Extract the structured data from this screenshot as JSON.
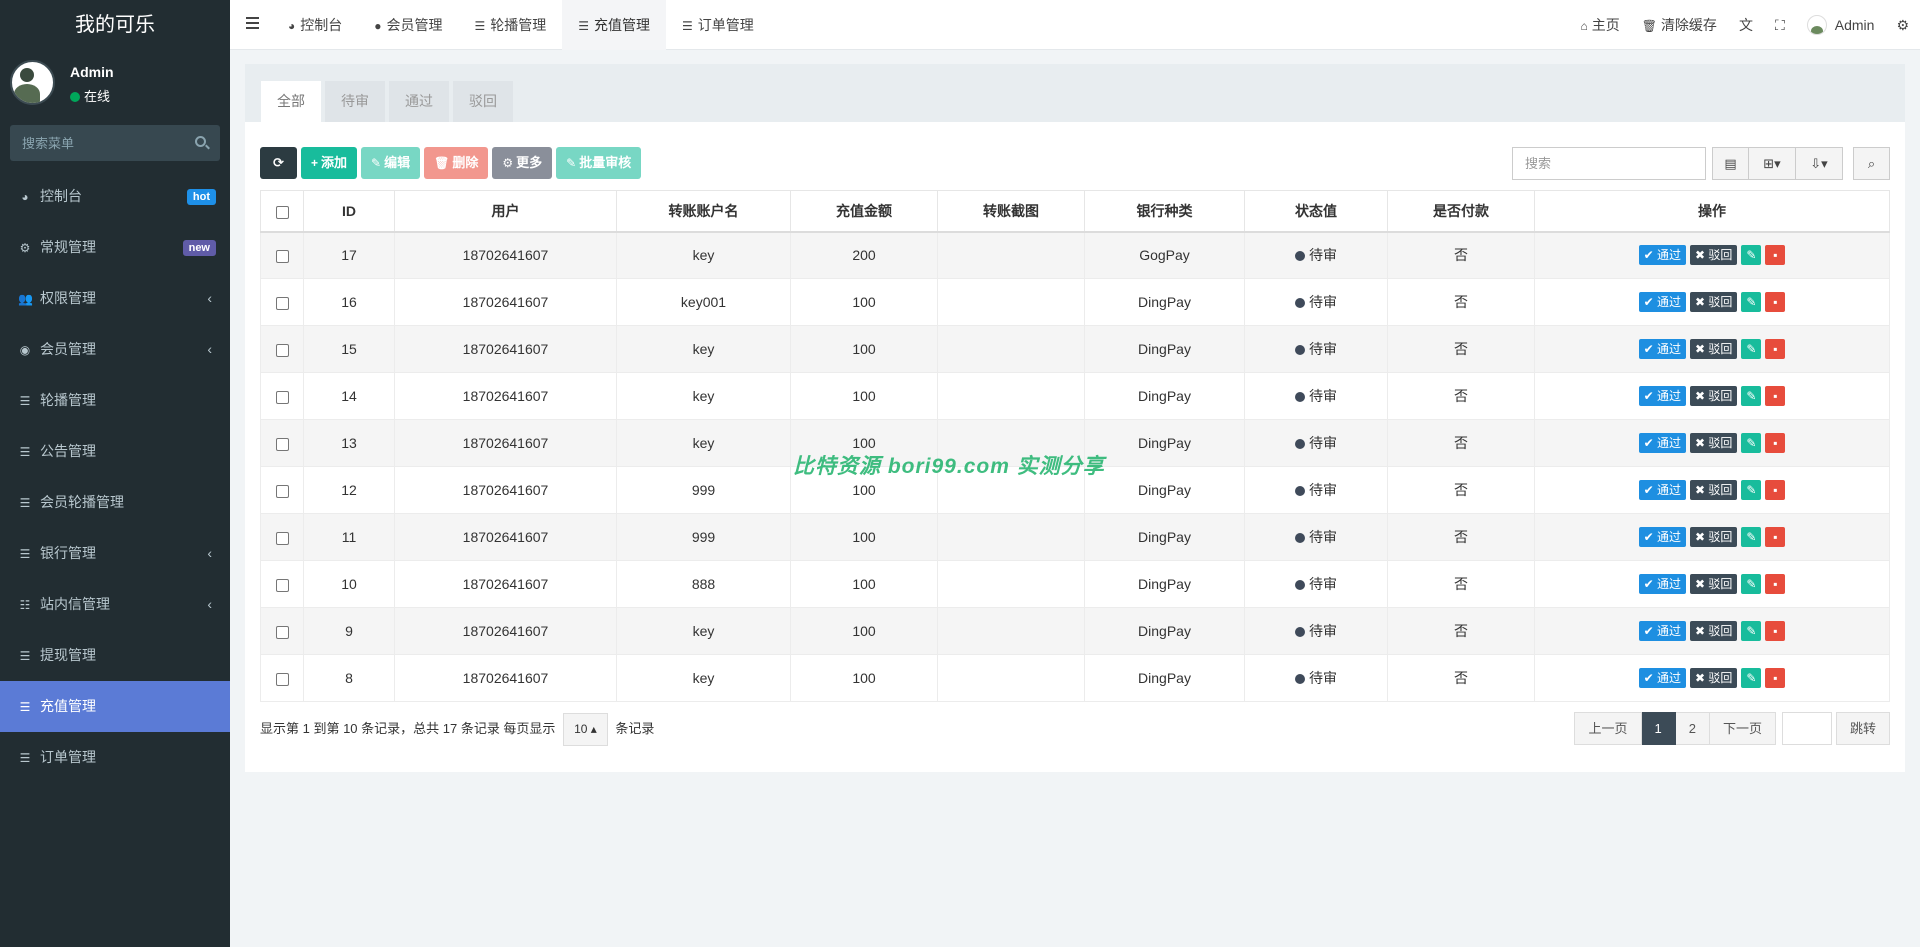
{
  "sidebar": {
    "logo": "我的可乐",
    "user": {
      "name": "Admin",
      "status": "在线"
    },
    "search_placeholder": "搜索菜单",
    "items": [
      {
        "label": "控制台",
        "icon": "dashboard-icon",
        "badge": "hot"
      },
      {
        "label": "常规管理",
        "icon": "cogs-icon",
        "badge": "new"
      },
      {
        "label": "权限管理",
        "icon": "users-icon",
        "caret": "‹"
      },
      {
        "label": "会员管理",
        "icon": "user-circle-icon",
        "caret": "‹"
      },
      {
        "label": "轮播管理",
        "icon": "list-icon"
      },
      {
        "label": "公告管理",
        "icon": "list-icon"
      },
      {
        "label": "会员轮播管理",
        "icon": "list-icon"
      },
      {
        "label": "银行管理",
        "icon": "list-icon",
        "caret": "‹"
      },
      {
        "label": "站内信管理",
        "icon": "list-alt-icon",
        "caret": "‹"
      },
      {
        "label": "提现管理",
        "icon": "list-icon"
      },
      {
        "label": "充值管理",
        "icon": "list-icon",
        "active": true
      },
      {
        "label": "订单管理",
        "icon": "list-icon"
      }
    ]
  },
  "topbar": {
    "tabs": [
      {
        "label": "控制台",
        "icon": "dashboard-icon"
      },
      {
        "label": "会员管理",
        "icon": "user-icon"
      },
      {
        "label": "轮播管理",
        "icon": "list-icon"
      },
      {
        "label": "充值管理",
        "icon": "list-icon",
        "active": true
      },
      {
        "label": "订单管理",
        "icon": "list-icon"
      }
    ],
    "home": "主页",
    "clear_cache": "清除缓存",
    "admin": "Admin"
  },
  "panel": {
    "tabs": [
      "全部",
      "待审",
      "通过",
      "驳回"
    ],
    "toolbar": {
      "add": "添加",
      "edit": "编辑",
      "delete": "删除",
      "more": "更多",
      "batch": "批量审核"
    },
    "search_placeholder": "搜索"
  },
  "table": {
    "columns": [
      "ID",
      "用户",
      "转账账户名",
      "充值金额",
      "转账截图",
      "银行种类",
      "状态值",
      "是否付款",
      "操作"
    ],
    "actions": {
      "pass": "通过",
      "reject": "驳回"
    },
    "rows": [
      {
        "id": "17",
        "user": "18702641607",
        "account": "key",
        "amount": "200",
        "screenshot": "",
        "bank": "GogPay",
        "status": "待审",
        "paid": "否"
      },
      {
        "id": "16",
        "user": "18702641607",
        "account": "key001",
        "amount": "100",
        "screenshot": "",
        "bank": "DingPay",
        "status": "待审",
        "paid": "否"
      },
      {
        "id": "15",
        "user": "18702641607",
        "account": "key",
        "amount": "100",
        "screenshot": "",
        "bank": "DingPay",
        "status": "待审",
        "paid": "否"
      },
      {
        "id": "14",
        "user": "18702641607",
        "account": "key",
        "amount": "100",
        "screenshot": "",
        "bank": "DingPay",
        "status": "待审",
        "paid": "否"
      },
      {
        "id": "13",
        "user": "18702641607",
        "account": "key",
        "amount": "100",
        "screenshot": "",
        "bank": "DingPay",
        "status": "待审",
        "paid": "否"
      },
      {
        "id": "12",
        "user": "18702641607",
        "account": "999",
        "amount": "100",
        "screenshot": "",
        "bank": "DingPay",
        "status": "待审",
        "paid": "否"
      },
      {
        "id": "11",
        "user": "18702641607",
        "account": "999",
        "amount": "100",
        "screenshot": "",
        "bank": "DingPay",
        "status": "待审",
        "paid": "否"
      },
      {
        "id": "10",
        "user": "18702641607",
        "account": "888",
        "amount": "100",
        "screenshot": "",
        "bank": "DingPay",
        "status": "待审",
        "paid": "否"
      },
      {
        "id": "9",
        "user": "18702641607",
        "account": "key",
        "amount": "100",
        "screenshot": "",
        "bank": "DingPay",
        "status": "待审",
        "paid": "否"
      },
      {
        "id": "8",
        "user": "18702641607",
        "account": "key",
        "amount": "100",
        "screenshot": "",
        "bank": "DingPay",
        "status": "待审",
        "paid": "否"
      }
    ]
  },
  "pagination": {
    "info_prefix": "显示第 1 到第 10 条记录，总共 17 条记录 每页显示",
    "page_size": "10",
    "info_suffix": "条记录",
    "prev": "上一页",
    "pages": [
      "1",
      "2"
    ],
    "current": "1",
    "next": "下一页",
    "jump": "跳转"
  },
  "watermark": "比特资源 bori99.com 实测分享"
}
